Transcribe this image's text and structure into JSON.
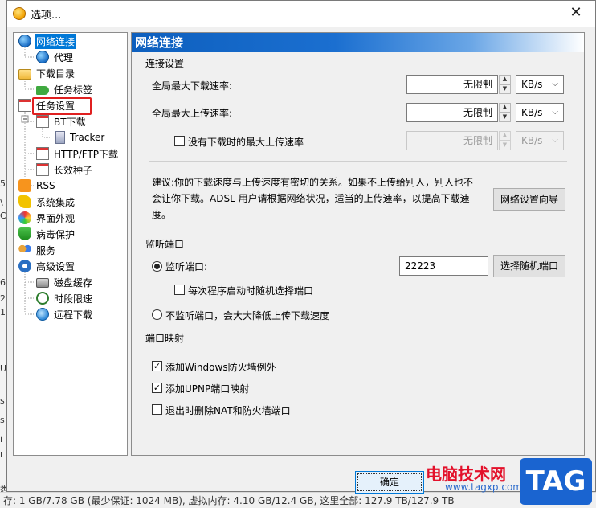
{
  "window": {
    "title": "选项...",
    "close_glyph": "✕"
  },
  "tree": {
    "items": [
      {
        "label": "网络连接",
        "icon": "globe-icon",
        "selected": true
      },
      {
        "label": "代理",
        "icon": "globe-icon"
      },
      {
        "label": "下载目录",
        "icon": "folder-icon"
      },
      {
        "label": "任务标签",
        "icon": "tag-icon"
      },
      {
        "label": "任务设置",
        "icon": "note-icon"
      },
      {
        "label": "BT下载",
        "icon": "note-icon"
      },
      {
        "label": "Tracker",
        "icon": "server-icon"
      },
      {
        "label": "HTTP/FTP下载",
        "icon": "note-icon"
      },
      {
        "label": "长效种子",
        "icon": "note-icon"
      },
      {
        "label": "RSS",
        "icon": "rss-icon"
      },
      {
        "label": "系统集成",
        "icon": "puzzle-icon"
      },
      {
        "label": "界面外观",
        "icon": "palette-icon"
      },
      {
        "label": "病毒保护",
        "icon": "shield-icon"
      },
      {
        "label": "服务",
        "icon": "people-icon"
      },
      {
        "label": "高级设置",
        "icon": "gear-icon"
      },
      {
        "label": "磁盘缓存",
        "icon": "disk-icon"
      },
      {
        "label": "时段限速",
        "icon": "clock-icon"
      },
      {
        "label": "远程下载",
        "icon": "remote-icon"
      }
    ],
    "highlight_color": "#e02020"
  },
  "panel": {
    "title": "网络连接",
    "connection": {
      "group_title": "连接设置",
      "max_download_label": "全局最大下载速率:",
      "max_download_value": "无限制",
      "max_download_unit": "KB/s",
      "max_upload_label": "全局最大上传速率:",
      "max_upload_value": "无限制",
      "max_upload_unit": "KB/s",
      "idle_upload_label": "没有下载时的最大上传速率",
      "idle_upload_value": "无限制",
      "idle_upload_unit": "KB/s",
      "hint": "建议:你的下载速度与上传速度有密切的关系。如果不上传给别人，别人也不会让你下载。ADSL 用户请根据网络状况，适当的上传速率，以提高下载速度。",
      "wizard_button": "网络设置向导"
    },
    "listen": {
      "group_title": "监听端口",
      "listen_label": "监听端口:",
      "port_value": "22223",
      "random_button": "选择随机端口",
      "random_each_label": "每次程序启动时随机选择端口",
      "no_listen_label": "不监听端口，会大大降低上传下载速度"
    },
    "mapping": {
      "group_title": "端口映射",
      "firewall_label": "添加Windows防火墙例外",
      "upnp_label": "添加UPNP端口映射",
      "cleanup_label": "退出时删除NAT和防火墙端口"
    }
  },
  "footer": {
    "ok_button": "确定"
  },
  "background": {
    "status_text": "存: 1 GB/7.78 GB (最少保证: 1024 MB), 虚拟内存: 4.10 GB/12.4 GB, 这里全部: 127.9 TB/127.9 TB"
  },
  "watermark": {
    "text": "电脑技术网",
    "url": "www.tagxp.com",
    "badge": "TAG",
    "text_color": "#e3102a",
    "badge_color": "#1a64d0"
  },
  "colors": {
    "accent": "#0078d7",
    "header_start": "#0d5fbe"
  }
}
